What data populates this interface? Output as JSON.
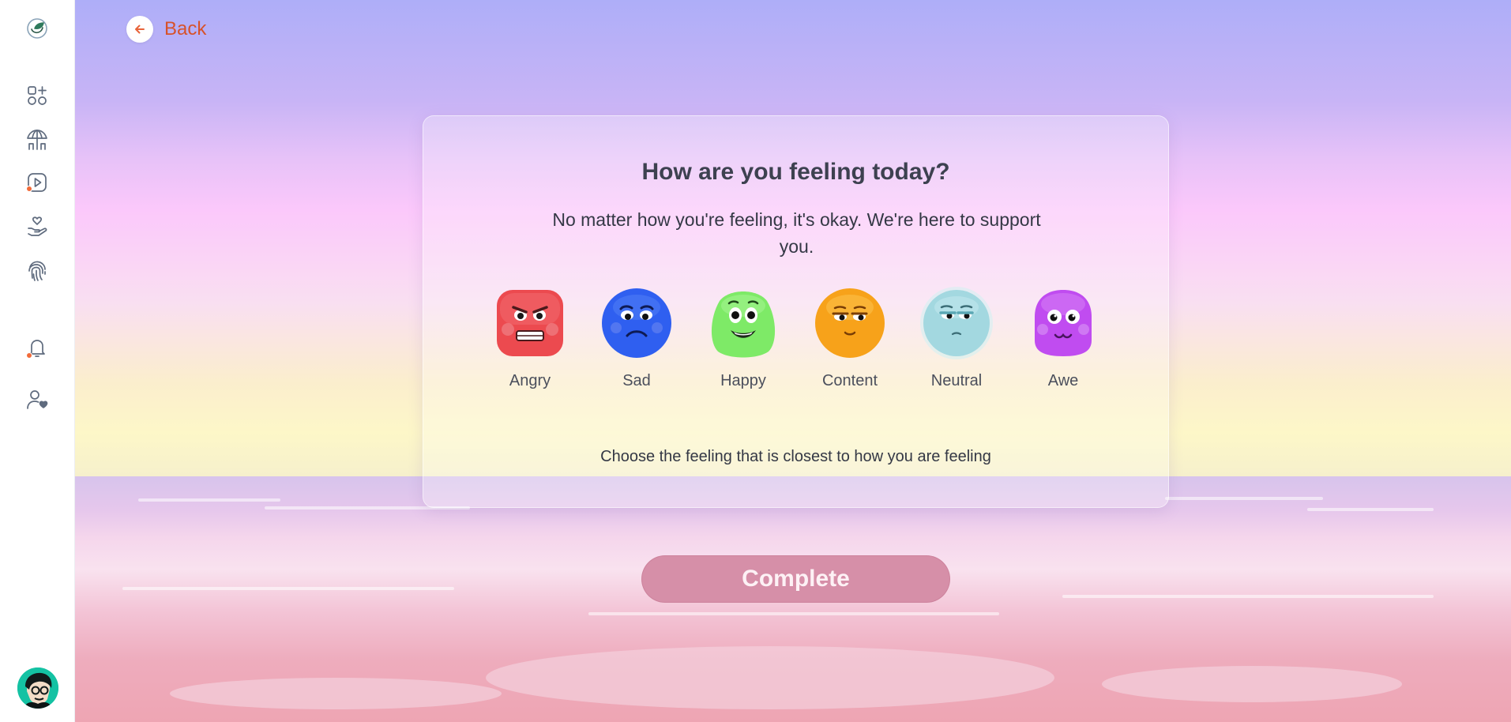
{
  "app": {
    "logo_icon": "leaf-globe-logo",
    "avatar_icon": "user-avatar"
  },
  "sidebar": {
    "items": [
      {
        "name": "dashboard",
        "icon": "apps-add-icon",
        "badge": false
      },
      {
        "name": "relax",
        "icon": "umbrella-beach-icon",
        "badge": false
      },
      {
        "name": "videos",
        "icon": "play-video-icon",
        "badge": true
      },
      {
        "name": "care",
        "icon": "hand-heart-icon",
        "badge": false
      },
      {
        "name": "identity",
        "icon": "fingerprint-icon",
        "badge": false
      },
      {
        "name": "notifications",
        "icon": "bell-icon",
        "badge": true
      },
      {
        "name": "profile",
        "icon": "user-heart-icon",
        "badge": false
      }
    ],
    "badge_color": "#f26b3a"
  },
  "back": {
    "label": "Back",
    "icon": "arrow-left-icon",
    "color": "#d7522a"
  },
  "card": {
    "title": "How are you feeling today?",
    "subtitle": "No matter how you're feeling, it's okay. We're here to support you.",
    "hint": "Choose the feeling that is closest to how you are feeling"
  },
  "moods": [
    {
      "label": "Angry",
      "color": "#ec4a4f"
    },
    {
      "label": "Sad",
      "color": "#2f5ff0"
    },
    {
      "label": "Happy",
      "color": "#7eea67"
    },
    {
      "label": "Content",
      "color": "#f7a21a"
    },
    {
      "label": "Neutral",
      "color": "#a3d8e0"
    },
    {
      "label": "Awe",
      "color": "#c04cf0"
    }
  ],
  "complete_button": {
    "label": "Complete",
    "color": "#d68fa8"
  }
}
